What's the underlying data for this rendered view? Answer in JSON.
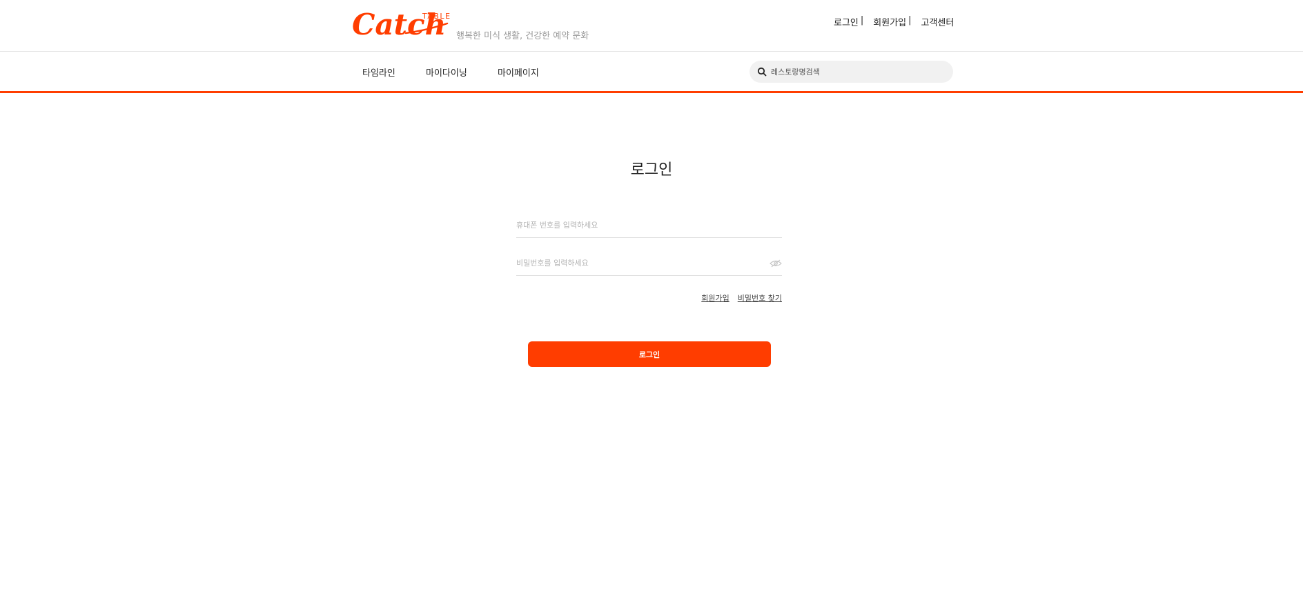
{
  "brand": {
    "logo_script": "Catch",
    "logo_word": "TABLE",
    "tagline": "행복한 미식 생활, 건강한 예약 문화",
    "accent_color": "#ff3d00"
  },
  "utility_nav": {
    "login": "로그인",
    "signup": "회원가입",
    "support": "고객센터",
    "separator": "|"
  },
  "main_nav": {
    "items": [
      {
        "label": "타임라인"
      },
      {
        "label": "마이다이닝"
      },
      {
        "label": "마이페이지"
      }
    ]
  },
  "search": {
    "icon": "search-icon",
    "placeholder": "레스토랑명검색"
  },
  "login_form": {
    "title": "로그인",
    "phone_placeholder": "휴대폰 번호를 입력하세요",
    "password_placeholder": "비밀번호를 입력하세요",
    "password_toggle_icon": "eye-off-icon",
    "signup_link": "회원가입",
    "find_password_link": "비밀번호 찾기",
    "submit_label": "로그인"
  }
}
